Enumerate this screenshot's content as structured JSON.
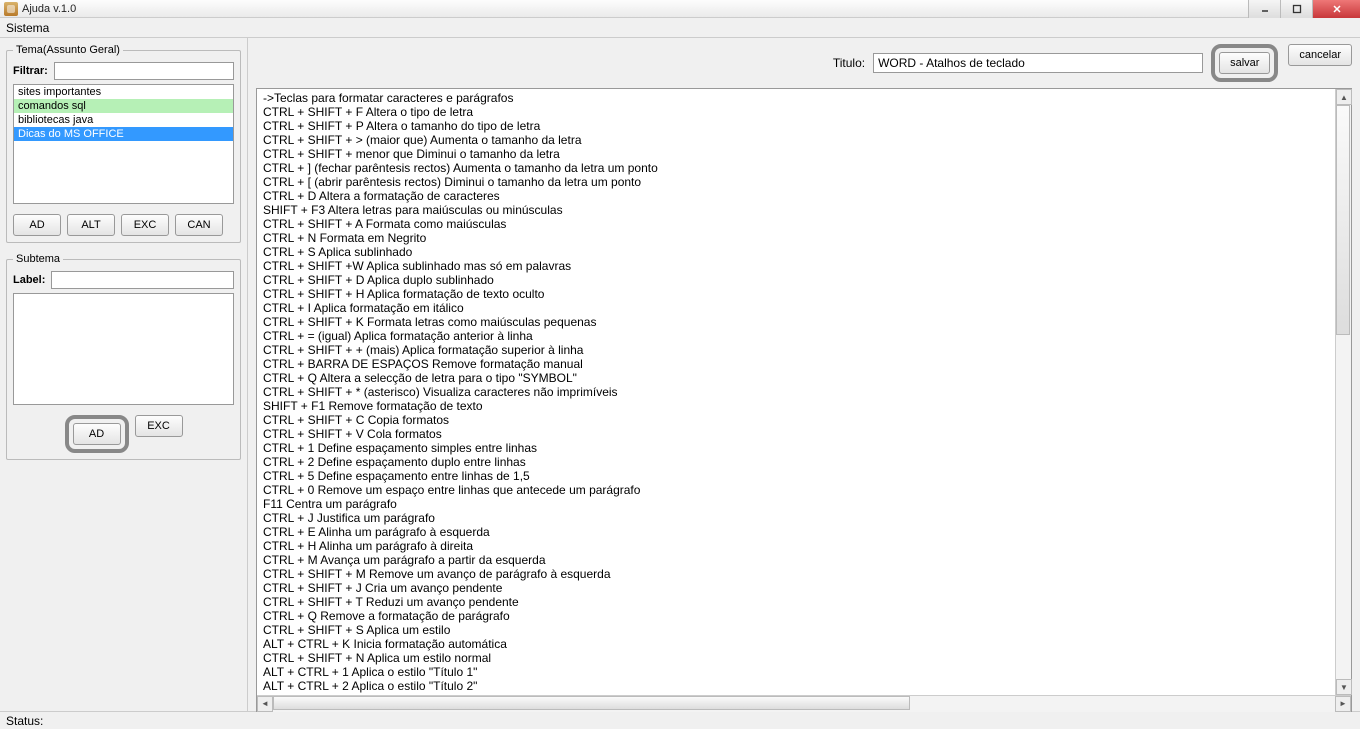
{
  "window": {
    "title": "Ajuda v.1.0"
  },
  "menubar": {
    "sistema": "Sistema"
  },
  "sidebar": {
    "tema_legend": "Tema(Assunto Geral)",
    "filtrar_label": "Filtrar:",
    "filtrar_value": "",
    "items": [
      {
        "label": "sites importantes",
        "state": ""
      },
      {
        "label": "comandos sql",
        "state": "green"
      },
      {
        "label": "bibliotecas java",
        "state": ""
      },
      {
        "label": "Dicas do MS OFFICE",
        "state": "selected"
      }
    ],
    "buttons": {
      "ad": "AD",
      "alt": "ALT",
      "exc": "EXC",
      "can": "CAN"
    },
    "subtema_legend": "Subtema",
    "label_label": "Label:",
    "label_value": "",
    "sub_buttons": {
      "ad": "AD",
      "exc": "EXC"
    }
  },
  "content": {
    "titulo_label": "Titulo:",
    "titulo_value": "WORD - Atalhos de teclado",
    "salvar": "salvar",
    "cancelar": "cancelar",
    "body": "->Teclas para formatar caracteres e parágrafos\nCTRL + SHIFT + F Altera o tipo de letra\nCTRL + SHIFT + P Altera o tamanho do tipo de letra\nCTRL + SHIFT + > (maior que) Aumenta o tamanho da letra\nCTRL + SHIFT + menor que Diminui o tamanho da letra\nCTRL + ] (fechar parêntesis rectos) Aumenta o tamanho da letra um ponto\nCTRL + [ (abrir parêntesis rectos) Diminui o tamanho da letra um ponto\nCTRL + D Altera a formatação de caracteres\nSHIFT + F3 Altera letras para maiúsculas ou minúsculas\nCTRL + SHIFT + A Formata como maiúsculas\nCTRL + N Formata em Negrito\nCTRL + S Aplica sublinhado\nCTRL + SHIFT +W Aplica sublinhado mas só em palavras\nCTRL + SHIFT + D Aplica duplo sublinhado\nCTRL + SHIFT + H Aplica formatação de texto oculto\nCTRL + I Aplica formatação em itálico\nCTRL + SHIFT + K Formata letras como maiúsculas pequenas\nCTRL + = (igual) Aplica formatação anterior à linha\nCTRL + SHIFT + + (mais) Aplica formatação superior à linha\nCTRL + BARRA DE ESPAÇOS Remove formatação manual\nCTRL + Q Altera a selecção de letra para o tipo \"SYMBOL\"\nCTRL + SHIFT + * (asterisco) Visualiza caracteres não imprimíveis\nSHIFT + F1 Remove formatação de texto\nCTRL + SHIFT + C Copia formatos\nCTRL + SHIFT + V Cola formatos\nCTRL + 1 Define espaçamento simples entre linhas\nCTRL + 2 Define espaçamento duplo entre linhas\nCTRL + 5 Define espaçamento entre linhas de 1,5\nCTRL + 0 Remove um espaço entre linhas que antecede um parágrafo\nF11 Centra um parágrafo\nCTRL + J Justifica um parágrafo\nCTRL + E Alinha um parágrafo à esquerda\nCTRL + H Alinha um parágrafo à direita\nCTRL + M Avança um parágrafo a partir da esquerda\nCTRL + SHIFT + M Remove um avanço de parágrafo à esquerda\nCTRL + SHIFT + J Cria um avanço pendente\nCTRL + SHIFT + T Reduzi um avanço pendente\nCTRL + Q Remove a formatação de parágrafo\nCTRL + SHIFT + S Aplica um estilo\nALT + CTRL + K Inicia formatação automática\nCTRL + SHIFT + N Aplica um estilo normal\nALT + CTRL + 1 Aplica o estilo \"Título 1\"\nALT + CTRL + 2 Aplica o estilo \"Título 2\""
  },
  "status": {
    "label": "Status:"
  }
}
